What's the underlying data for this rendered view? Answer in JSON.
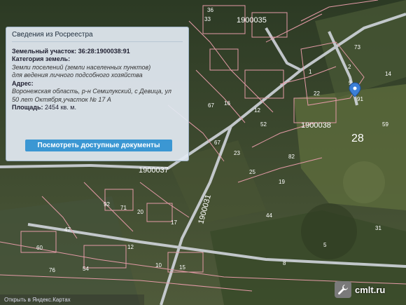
{
  "info_panel": {
    "title": "Сведения из Росреестра",
    "parcel": "Земельный участок: 36:28:1900038:91",
    "category_label": "Категория земель:",
    "category_value_1": "Земли поселений (земли населенных пунктов)",
    "category_value_2": "для ведения личного подсобного хозяйства",
    "address_label": "Адрес:",
    "address_value_1": "Воронежская область, р-н Семилукский, с Девица, ул",
    "address_value_2": "50 лет Октября,участок № 17 А",
    "area_label": "Площадь:",
    "area_value": "2454 кв. м.",
    "docs_button": "Посмотреть доступные документы"
  },
  "map": {
    "quarter_labels": [
      "1900035",
      "1900038",
      "1900037",
      "1900031"
    ],
    "zone_label": "28",
    "parcel_numbers": [
      "33",
      "36",
      "1",
      "2",
      "22",
      "91",
      "9",
      "67",
      "12",
      "52",
      "67",
      "16",
      "23",
      "25",
      "19",
      "20",
      "71",
      "92",
      "17",
      "47",
      "60",
      "76",
      "54",
      "12",
      "10",
      "15",
      "8",
      "5",
      "31",
      "59",
      "44",
      "82",
      "73",
      "14"
    ],
    "colors": {
      "boundary": "#e39aa6",
      "road": "#d9dde6",
      "label": "#ffffff",
      "marker": "#3c7fd6"
    },
    "marker": "map-pin-icon"
  },
  "statusbar": {
    "text": "Открыть в Яндекс.Картах"
  },
  "watermark": {
    "text": "cmlt.ru",
    "icon": "wrench-icon"
  }
}
